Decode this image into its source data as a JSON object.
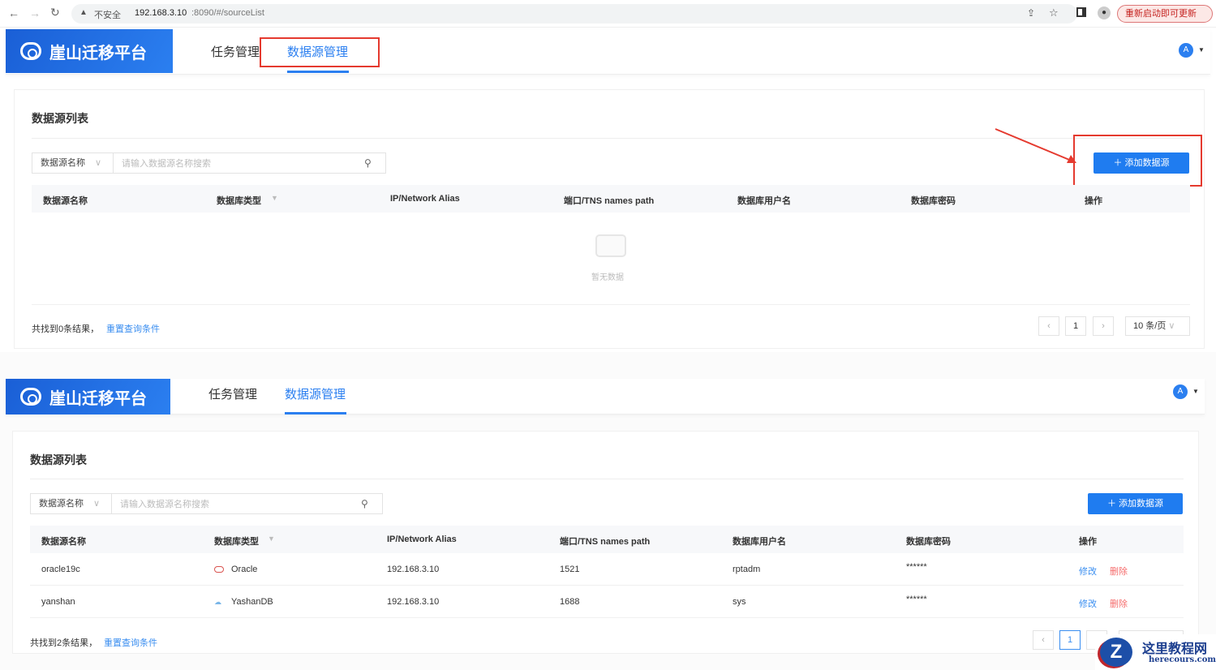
{
  "browser": {
    "insecure_label": "不安全",
    "url_host": "192.168.3.10",
    "url_rest": ":8090/#/sourceList",
    "update_button": "重新启动即可更新"
  },
  "app": {
    "brand": "崖山迁移平台",
    "tabs": [
      {
        "label": "任务管理"
      },
      {
        "label": "数据源管理"
      }
    ],
    "avatar_glyph": "A"
  },
  "page": {
    "title": "数据源列表",
    "search": {
      "field_select": "数据源名称",
      "placeholder": "请输入数据源名称搜索"
    },
    "add_button": "添加数据源",
    "columns": [
      "数据源名称",
      "数据库类型",
      "IP/Network Alias",
      "端口/TNS names path",
      "数据库用户名",
      "数据库密码",
      "操作"
    ]
  },
  "screen1": {
    "empty_text": "暂无数据",
    "result_count": "共找到0条结果，",
    "reset_link": "重置查询条件",
    "page": "1",
    "page_size": "10 条/页"
  },
  "screen2": {
    "rows": [
      {
        "name": "oracle19c",
        "type": "Oracle",
        "ip": "192.168.3.10",
        "port": "1521",
        "user": "rptadm",
        "password": "******",
        "edit": "修改",
        "delete": "删除"
      },
      {
        "name": "yanshan",
        "type": "YashanDB",
        "ip": "192.168.3.10",
        "port": "1688",
        "user": "sys",
        "password": "******",
        "edit": "修改",
        "delete": "删除"
      }
    ],
    "result_count": "共找到2条结果，",
    "reset_link": "重置查询条件",
    "page": "1"
  },
  "watermark": {
    "title": "这里教程网",
    "domain": "herecours.com"
  },
  "colors": {
    "primary": "#1f7cf0",
    "danger": "#f56c6c",
    "annotation": "#e53a2f"
  }
}
